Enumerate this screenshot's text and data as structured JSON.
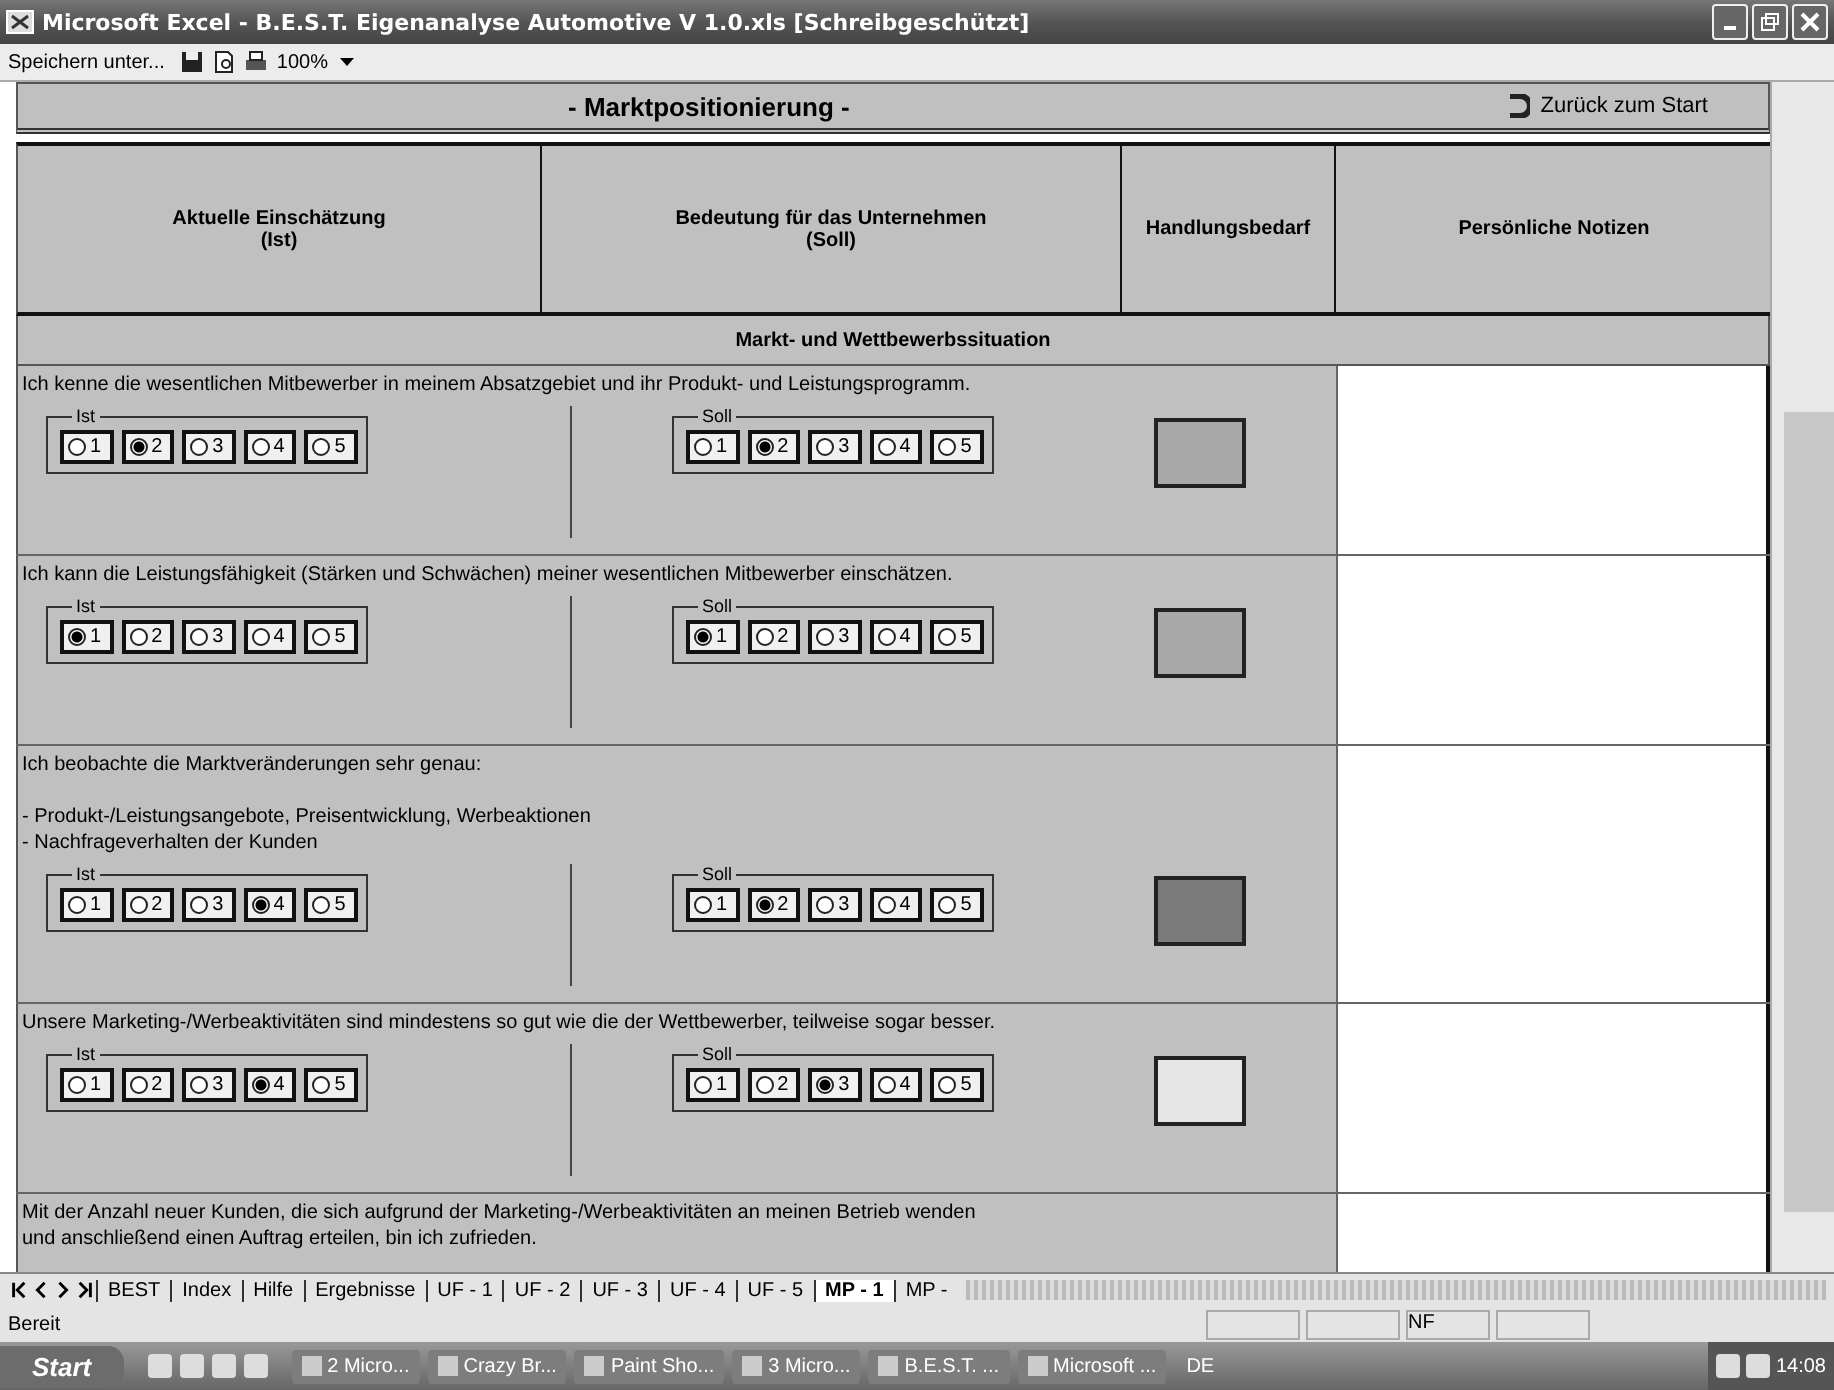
{
  "window": {
    "title": "Microsoft Excel - B.E.S.T. Eigenanalyse Automotive V 1.0.xls  [Schreibgeschützt]"
  },
  "toolbar": {
    "save_as": "Speichern unter...",
    "zoom": "100%"
  },
  "sheet": {
    "title": "- Marktpositionierung -",
    "back_link": "Zurück zum Start",
    "columns": [
      {
        "lines": [
          "Aktuelle Einschätzung",
          "(Ist)"
        ]
      },
      {
        "lines": [
          "Bedeutung für das Unternehmen",
          "(Soll)"
        ]
      },
      {
        "lines": [
          "Handlungsbedarf"
        ]
      },
      {
        "lines": [
          "Persönliche Notizen"
        ]
      }
    ],
    "section": "Markt- und Wettbewerbssituation",
    "questions": [
      {
        "lines": [
          "Ich kenne die wesentlichen Mitbewerber in meinem Absatzgebiet und ihr Produkt- und Leistungsprogramm."
        ],
        "ist": {
          "label": "Ist",
          "options": [
            {
              "label": "1",
              "selected": false
            },
            {
              "label": "2",
              "selected": true
            },
            {
              "label": "3",
              "selected": false
            },
            {
              "label": "4",
              "selected": false
            },
            {
              "label": "5",
              "selected": false
            }
          ]
        },
        "soll": {
          "label": "Soll",
          "options": [
            {
              "label": "1",
              "selected": false
            },
            {
              "label": "2",
              "selected": true
            },
            {
              "label": "3",
              "selected": false
            },
            {
              "label": "4",
              "selected": false
            },
            {
              "label": "5",
              "selected": false
            }
          ]
        },
        "color": "#a9a9a9"
      },
      {
        "lines": [
          "Ich kann die Leistungsfähigkeit (Stärken und Schwächen) meiner wesentlichen Mitbewerber einschätzen."
        ],
        "ist": {
          "label": "Ist",
          "options": [
            {
              "label": "1",
              "selected": true
            },
            {
              "label": "2",
              "selected": false
            },
            {
              "label": "3",
              "selected": false
            },
            {
              "label": "4",
              "selected": false
            },
            {
              "label": "5",
              "selected": false
            }
          ]
        },
        "soll": {
          "label": "Soll",
          "options": [
            {
              "label": "1",
              "selected": true
            },
            {
              "label": "2",
              "selected": false
            },
            {
              "label": "3",
              "selected": false
            },
            {
              "label": "4",
              "selected": false
            },
            {
              "label": "5",
              "selected": false
            }
          ]
        },
        "color": "#a9a9a9"
      },
      {
        "lines": [
          "Ich beobachte die Marktveränderungen sehr genau:"
        ],
        "bullets": [
          "- Produkt-/Leistungsangebote, Preisentwicklung, Werbeaktionen",
          "- Nachfrageverhalten der Kunden"
        ],
        "ist": {
          "label": "Ist",
          "options": [
            {
              "label": "1",
              "selected": false
            },
            {
              "label": "2",
              "selected": false
            },
            {
              "label": "3",
              "selected": false
            },
            {
              "label": "4",
              "selected": true
            },
            {
              "label": "5",
              "selected": false
            }
          ]
        },
        "soll": {
          "label": "Soll",
          "options": [
            {
              "label": "1",
              "selected": false
            },
            {
              "label": "2",
              "selected": true
            },
            {
              "label": "3",
              "selected": false
            },
            {
              "label": "4",
              "selected": false
            },
            {
              "label": "5",
              "selected": false
            }
          ]
        },
        "color": "#7a7a7a"
      },
      {
        "lines": [
          "Unsere Marketing-/Werbeaktivitäten sind mindestens so gut wie die der Wettbewerber, teilweise sogar besser."
        ],
        "ist": {
          "label": "Ist",
          "options": [
            {
              "label": "1",
              "selected": false
            },
            {
              "label": "2",
              "selected": false
            },
            {
              "label": "3",
              "selected": false
            },
            {
              "label": "4",
              "selected": true
            },
            {
              "label": "5",
              "selected": false
            }
          ]
        },
        "soll": {
          "label": "Soll",
          "options": [
            {
              "label": "1",
              "selected": false
            },
            {
              "label": "2",
              "selected": false
            },
            {
              "label": "3",
              "selected": true
            },
            {
              "label": "4",
              "selected": false
            },
            {
              "label": "5",
              "selected": false
            }
          ]
        },
        "color": "#e6e6e6"
      },
      {
        "lines": [
          "Mit der Anzahl neuer Kunden, die sich aufgrund der Marketing-/Werbeaktivitäten an meinen Betrieb wenden",
          "und anschließend einen Auftrag erteilen, bin ich zufrieden."
        ]
      }
    ]
  },
  "sheet_tabs": [
    {
      "label": "BEST",
      "selected": false
    },
    {
      "label": "Index",
      "selected": false
    },
    {
      "label": "Hilfe",
      "selected": false
    },
    {
      "label": "Ergebnisse",
      "selected": false
    },
    {
      "label": "UF - 1",
      "selected": false
    },
    {
      "label": "UF - 2",
      "selected": false
    },
    {
      "label": "UF - 3",
      "selected": false
    },
    {
      "label": "UF - 4",
      "selected": false
    },
    {
      "label": "UF - 5",
      "selected": false
    },
    {
      "label": "MP - 1",
      "selected": true
    },
    {
      "label": "MP -",
      "selected": false
    }
  ],
  "status_bar": {
    "status": "Bereit",
    "indicator": "NF"
  },
  "taskbar": {
    "start": "Start",
    "items": [
      "2 Micro...",
      "Crazy Br...",
      "Paint Sho...",
      "3 Micro...",
      "B.E.S.T. ...",
      "Microsoft ..."
    ],
    "language": "DE",
    "clock": "14:08"
  }
}
